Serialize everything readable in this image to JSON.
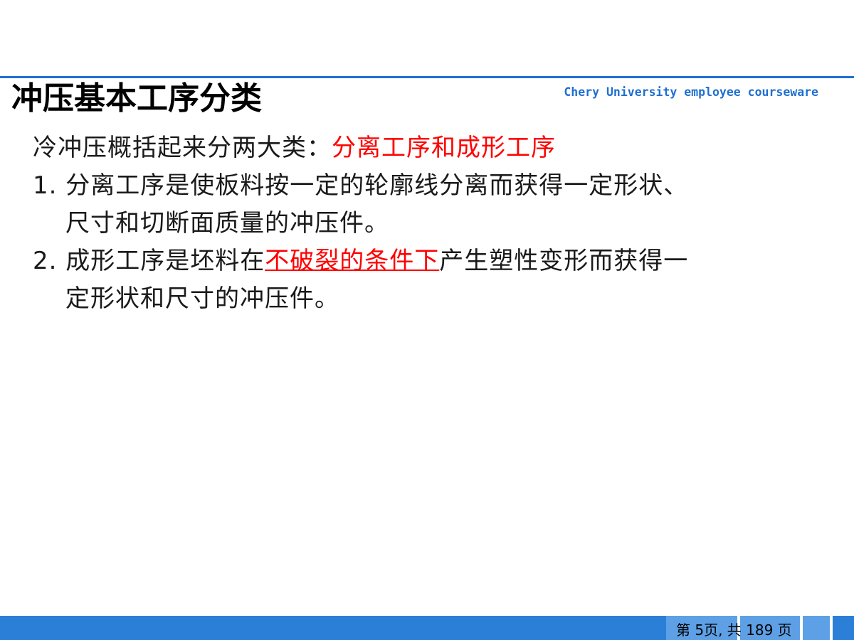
{
  "slide": {
    "title": "冲压基本工序分类",
    "brand": "Chery University employee courseware"
  },
  "content": {
    "intro_prefix": "冷冲压概括起来分两大类：",
    "intro_highlight": "分离工序和成形工序",
    "item1_line1": "1. 分离工序是使板料按一定的轮廓线分离而获得一定形状、",
    "item1_line2": "尺寸和切断面质量的冲压件。",
    "item2_prefix": "2. 成形工序是坯料在",
    "item2_highlight": "不破裂的条件下",
    "item2_suffix": "产生塑性变形而获得一",
    "item2_line2": "定形状和尺寸的冲压件。"
  },
  "footer": {
    "page_text": "第 5页,  共 189 页"
  },
  "colors": {
    "accent": "#1f6fd1",
    "highlight": "#ff0000",
    "footer_bar": "#2b7fd6",
    "footer_block": "#5ea0e6"
  }
}
